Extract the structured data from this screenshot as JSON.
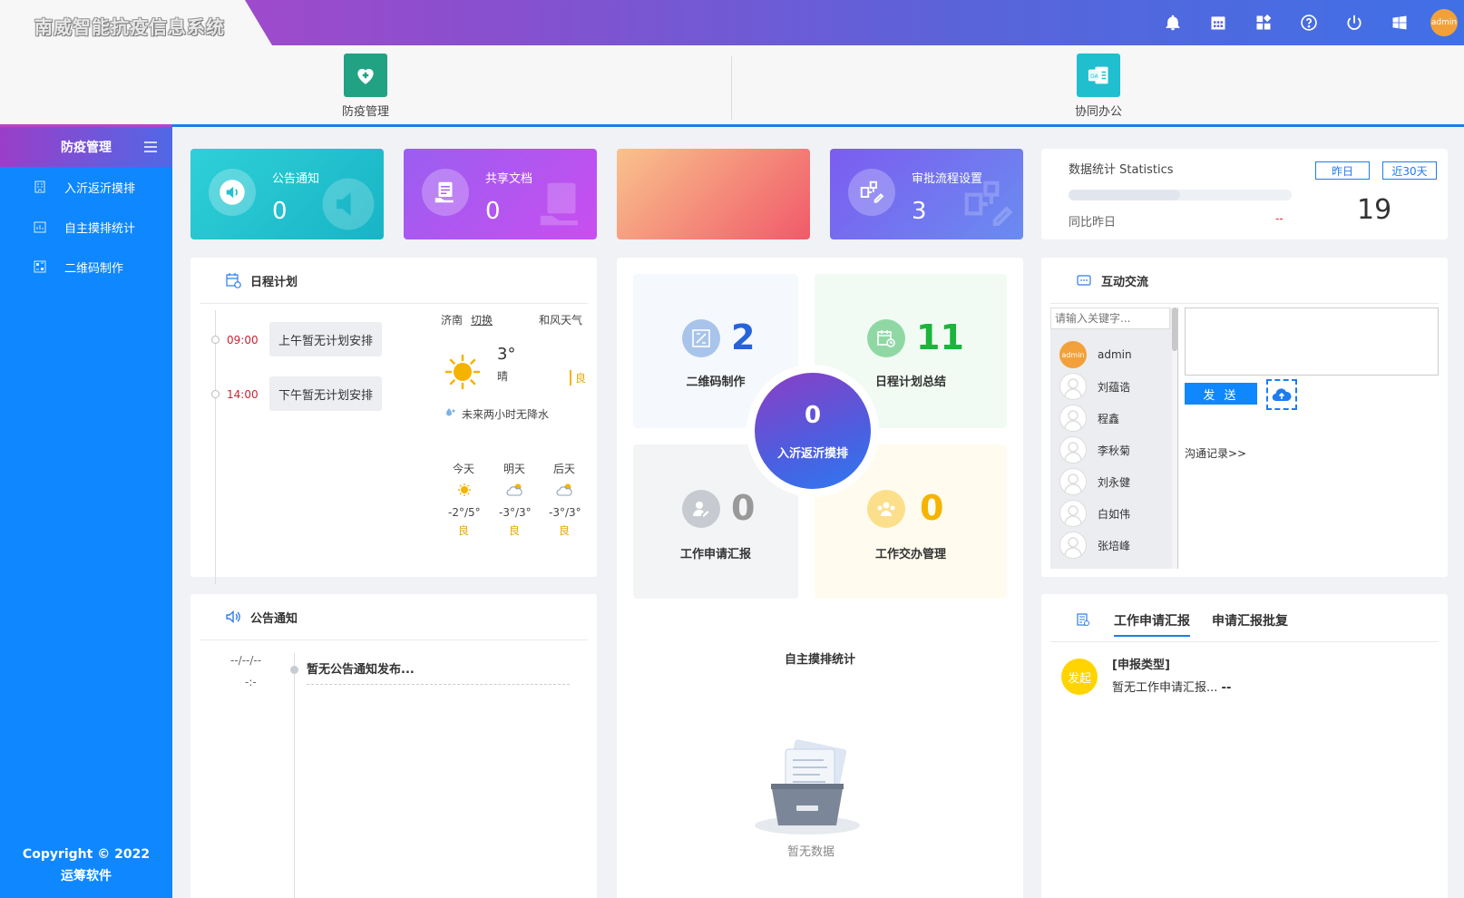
{
  "header": {
    "title": "南威智能抗疫信息系统",
    "user_avatar": "admin",
    "icons": [
      "bell-icon",
      "calendar-icon",
      "apps-icon",
      "help-icon",
      "power-icon",
      "windows-icon"
    ]
  },
  "modules": [
    {
      "label": "防疫管理",
      "color": "#20a283"
    },
    {
      "label": "协同办公",
      "color": "#1fbfcf"
    }
  ],
  "sidebar": {
    "title": "防疫管理",
    "items": [
      {
        "label": "入沂返沂摸排"
      },
      {
        "label": "自主摸排统计"
      },
      {
        "label": "二维码制作"
      }
    ],
    "copyright": "Copyright © 2022",
    "company": "运筹软件"
  },
  "cards": [
    {
      "title": "公告通知",
      "value": "0"
    },
    {
      "title": "共享文档",
      "value": "0"
    },
    {
      "title": "",
      "value": ""
    },
    {
      "title": "审批流程设置",
      "value": "3"
    }
  ],
  "statistics": {
    "title": "数据统计 Statistics",
    "btn_yesterday": "昨日",
    "btn_30days": "近30天",
    "compare_label": "同比昨日",
    "compare_value": "--",
    "value": "19",
    "progress": 0.5
  },
  "schedule": {
    "title": "日程计划",
    "items": [
      {
        "time": "09:00",
        "text": "上午暂无计划安排"
      },
      {
        "time": "14:00",
        "text": "下午暂无计划安排"
      }
    ]
  },
  "weather": {
    "city": "济南",
    "switch": "切换",
    "source": "和风天气",
    "temp": "3°",
    "condition": "晴",
    "aqi": "良",
    "forecast_note": "未来两小时无降水",
    "days": [
      {
        "label": "今天",
        "range": "-2°/5°",
        "aqi": "良",
        "icon": "sun-icon"
      },
      {
        "label": "明天",
        "range": "-3°/3°",
        "aqi": "良",
        "icon": "cloudy-sun-icon"
      },
      {
        "label": "后天",
        "range": "-3°/3°",
        "aqi": "良",
        "icon": "cloudy-sun-icon"
      }
    ]
  },
  "center": {
    "quads": [
      {
        "label": "二维码制作",
        "value": "2",
        "color": "#2563d8"
      },
      {
        "label": "日程计划总结",
        "value": "11",
        "color": "#1cb53b"
      },
      {
        "label": "工作申请汇报",
        "value": "0",
        "color": "#999999"
      },
      {
        "label": "工作交办管理",
        "value": "0",
        "color": "#f4b400"
      }
    ],
    "circle_value": "0",
    "circle_label": "入沂返沂摸排",
    "stat_title": "自主摸排统计",
    "empty_text": "暂无数据"
  },
  "chat": {
    "title": "互动交流",
    "search_placeholder": "请输入关键字...",
    "users": [
      "admin",
      "刘蕴诰",
      "程鑫",
      "李秋菊",
      "刘永健",
      "白如伟",
      "张培峰"
    ],
    "admin_avatar": "admin",
    "send_label": "发 送",
    "log_link": "沟通记录>>"
  },
  "notice": {
    "title": "公告通知",
    "date": "--/--/--",
    "time": "-:-",
    "text": "暂无公告通知发布..."
  },
  "report": {
    "tabs": [
      "工作申请汇报",
      "申请汇报批复"
    ],
    "badge": "发起",
    "type_label": "[申报类型]",
    "text": "暂无工作申请汇报...",
    "suffix": "--"
  }
}
